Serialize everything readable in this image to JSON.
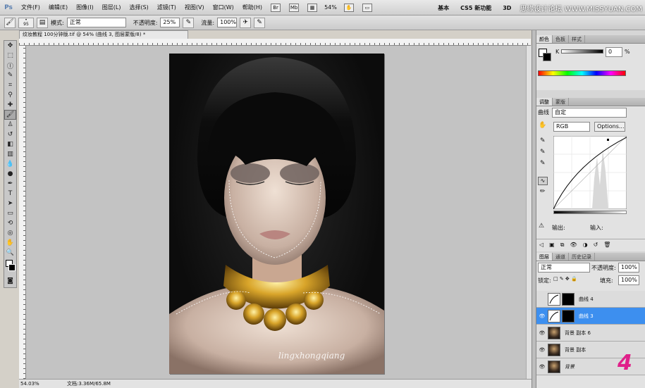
{
  "app": {
    "logo": "Ps",
    "menus": [
      "文件(F)",
      "编辑(E)",
      "图像(I)",
      "图层(L)",
      "选择(S)",
      "滤镜(T)",
      "视图(V)",
      "窗口(W)",
      "帮助(H)"
    ],
    "zoom": "54%",
    "workspace_items": [
      "基本",
      "CS5 新功能",
      "3D"
    ],
    "watermark": "思缘设计论坛 WWW.MISSYUAN.COM"
  },
  "options": {
    "mode_label": "模式:",
    "mode_value": "正常",
    "opacity_label": "不透明度:",
    "opacity_value": "25%",
    "flow_label": "流量:",
    "flow_value": "100%",
    "brush_size": "95"
  },
  "document": {
    "tab_title": "纹妆教程 100分钟版.tif @ 54% (曲线 3, 图层蒙版/8) *",
    "ruler_numbers": [
      "14",
      "12",
      "10",
      "8",
      "6",
      "4",
      "2",
      "0",
      "2",
      "4",
      "6",
      "8",
      "10",
      "12",
      "14",
      "16",
      "18",
      "20",
      "22",
      "24",
      "26",
      "28",
      "30",
      "32",
      "34",
      "36",
      "38",
      "40",
      "42",
      "44",
      "46"
    ],
    "signature": "lingxhongqiang",
    "status_zoom": "54.03%",
    "status_doc": "文档:3.36M/65.8M"
  },
  "color_panel": {
    "tabs": [
      "颜色",
      "色板",
      "样式"
    ],
    "channel": "K",
    "value": "0",
    "unit": "%"
  },
  "adjust_panel": {
    "tabs": [
      "调整",
      "蒙版"
    ],
    "type_label": "曲线",
    "preset_value": "自定",
    "channel_value": "RGB",
    "options_button": "Options...",
    "output_label": "输出:",
    "input_label": "输入:"
  },
  "layers_panel": {
    "tabs": [
      "图层",
      "通道",
      "历史记录"
    ],
    "blend_mode": "正常",
    "opacity_label": "不透明度:",
    "opacity_value": "100%",
    "lock_label": "锁定:",
    "fill_label": "填充:",
    "fill_value": "100%",
    "layers": [
      {
        "name": "曲线 4",
        "kind": "curve",
        "visible": false,
        "selected": false
      },
      {
        "name": "曲线 3",
        "kind": "curve",
        "visible": true,
        "selected": true
      },
      {
        "name": "背景 副本 6",
        "kind": "photo",
        "visible": true,
        "selected": false
      },
      {
        "name": "背景 副本",
        "kind": "photo",
        "visible": true,
        "selected": false
      },
      {
        "name": "背景",
        "kind": "photo",
        "visible": true,
        "selected": false
      }
    ],
    "corner_mark": "4"
  },
  "colors": {
    "selection": "#3d8fef",
    "corner_mark": "#e0208a"
  }
}
